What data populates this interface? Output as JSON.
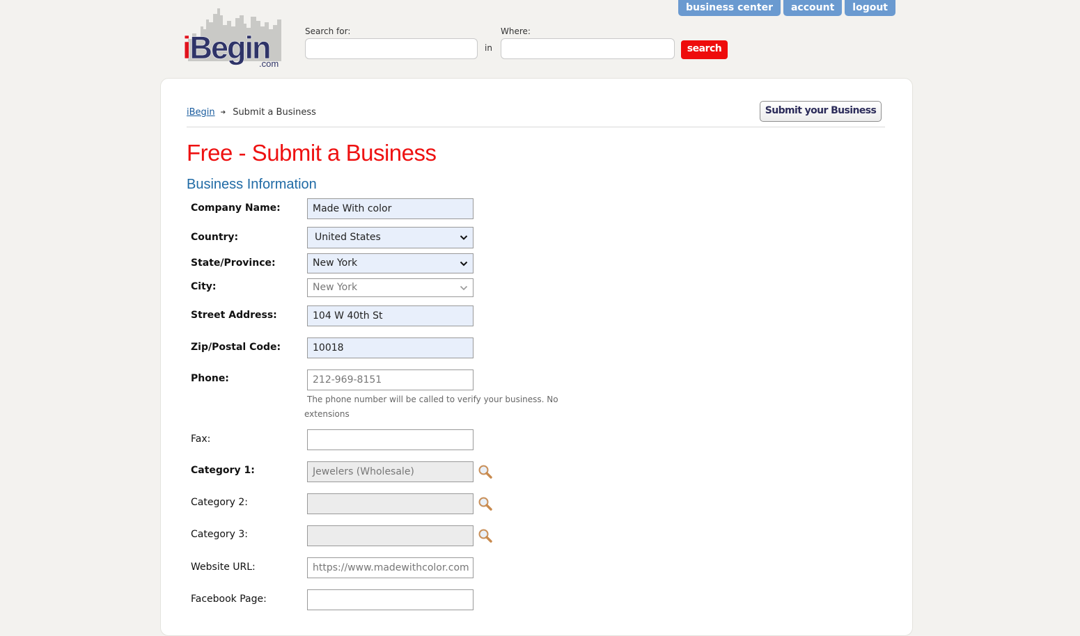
{
  "logo": {
    "prefix": "i",
    "rest": "Begin",
    "suffix": ".com"
  },
  "top_nav": [
    {
      "label": "business center"
    },
    {
      "label": "account"
    },
    {
      "label": "logout"
    }
  ],
  "search": {
    "search_for_label": "Search for:",
    "search_for_value": "",
    "in_label": "in",
    "where_label": "Where:",
    "where_value": "",
    "button_label": "search"
  },
  "breadcrumb": {
    "home": "iBegin",
    "separator_icon": "arrow-right-icon",
    "current": "Submit a Business"
  },
  "submit_button": "Submit your Business",
  "page_title": "Free - Submit a Business",
  "section_title": "Business Information",
  "form": {
    "company_name": {
      "label": "Company Name:",
      "value": "Made With color",
      "required": true
    },
    "country": {
      "label": "Country:",
      "value": "United States",
      "required": true
    },
    "state": {
      "label": "State/Province:",
      "value": "New York",
      "required": true
    },
    "city": {
      "label": "City:",
      "value": "New York",
      "required": true
    },
    "street": {
      "label": "Street Address:",
      "value": "104 W 40th St",
      "required": true
    },
    "zip": {
      "label": "Zip/Postal Code:",
      "value": "10018",
      "required": true
    },
    "phone": {
      "label": "Phone:",
      "value": "212-969-8151",
      "required": true,
      "hint_line1": "The phone number will be called to verify your business. No",
      "hint_line2": "extensions"
    },
    "fax": {
      "label": "Fax:",
      "value": ""
    },
    "category1": {
      "label": "Category 1:",
      "value": "Jewelers (Wholesale)",
      "required": true
    },
    "category2": {
      "label": "Category 2:",
      "value": ""
    },
    "category3": {
      "label": "Category 3:",
      "value": ""
    },
    "website": {
      "label": "Website URL:",
      "value": "https://www.madewithcolor.com"
    },
    "facebook": {
      "label": "Facebook Page:",
      "value": ""
    }
  },
  "colors": {
    "title_red": "#ee1111",
    "section_blue": "#1f6aa5",
    "nav_blue": "#6a9ad0",
    "search_red": "#ee0c0c",
    "filled_field_bg": "#e8effb"
  }
}
